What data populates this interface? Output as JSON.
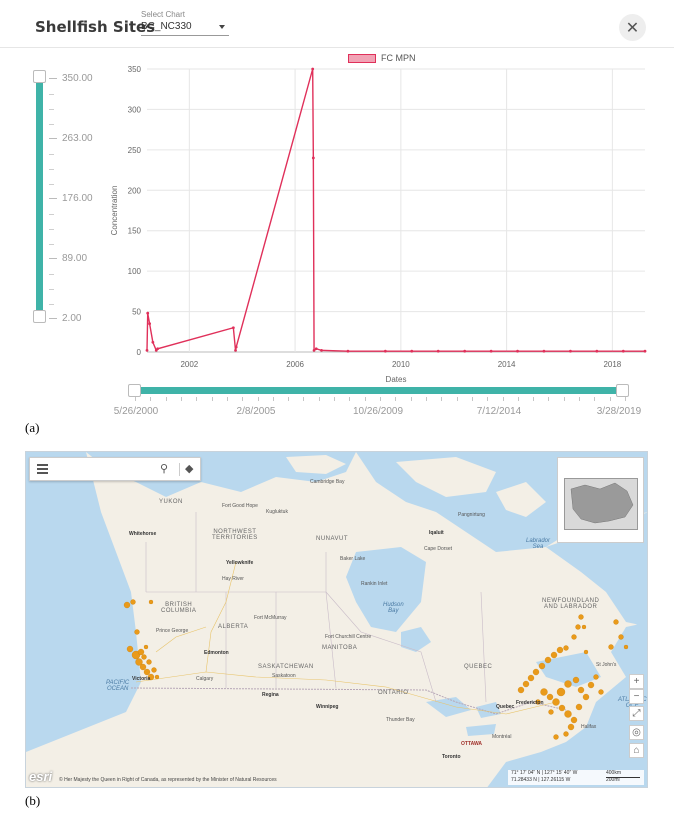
{
  "header": {
    "title": "Shellfish Sites",
    "select_label": "Select Chart",
    "select_value": "BC_NC330",
    "close_glyph": "✕"
  },
  "vslider": {
    "ticks": [
      "350.00",
      "263.00",
      "176.00",
      "89.00",
      "2.00"
    ],
    "range": [
      2.0,
      350.0
    ]
  },
  "hslider": {
    "labels": [
      "5/26/2000",
      "2/8/2005",
      "10/26/2009",
      "7/12/2014",
      "3/28/2019"
    ]
  },
  "chart_data": {
    "type": "line",
    "xlabel": "Dates",
    "ylabel": "Concentration",
    "xlim": [
      "2000-05-26",
      "2019-03-28"
    ],
    "ylim": [
      0,
      350
    ],
    "x_ticks": [
      "2002",
      "2006",
      "2010",
      "2014",
      "2018"
    ],
    "y_ticks": [
      "0",
      "50",
      "100",
      "150",
      "200",
      "250",
      "300",
      "350"
    ],
    "grid": true,
    "legend": "top-center",
    "color": "#e0305a",
    "series": [
      {
        "name": "FC MPN",
        "points": [
          [
            "2000-05-26",
            2
          ],
          [
            "2000-06-05",
            48
          ],
          [
            "2000-07-01",
            35
          ],
          [
            "2000-08-15",
            12
          ],
          [
            "2000-10-01",
            2
          ],
          [
            "2000-10-20",
            4
          ],
          [
            "2003-09-01",
            30
          ],
          [
            "2003-10-01",
            2
          ],
          [
            "2003-10-10",
            6
          ],
          [
            "2006-09-01",
            350
          ],
          [
            "2006-09-10",
            240
          ],
          [
            "2006-09-20",
            2
          ],
          [
            "2006-10-20",
            4
          ],
          [
            "2007-01-01",
            2
          ],
          [
            "2008-01-01",
            1
          ],
          [
            "2009-06-01",
            1
          ],
          [
            "2010-06-01",
            1
          ],
          [
            "2011-06-01",
            1
          ],
          [
            "2012-06-01",
            1
          ],
          [
            "2013-06-01",
            1
          ],
          [
            "2014-06-01",
            1
          ],
          [
            "2015-06-01",
            1
          ],
          [
            "2016-06-01",
            1
          ],
          [
            "2017-06-01",
            1
          ],
          [
            "2018-06-01",
            1
          ],
          [
            "2019-03-28",
            1
          ]
        ]
      }
    ]
  },
  "captions": {
    "a": "(a)",
    "b": "(b)"
  },
  "map": {
    "labels": {
      "yukon": "YUKON",
      "nwt": "NORTHWEST\nTERRITORIES",
      "nunavut": "NUNAVUT",
      "bc": "BRITISH\nCOLUMBIA",
      "alberta": "ALBERTA",
      "sask": "SASKATCHEWAN",
      "manitoba": "MANITOBA",
      "ontario": "ONTARIO",
      "quebec": "QUEBEC",
      "nfl": "NEWFOUNDLAND\nAND LABRADOR",
      "hudson": "Hudson\nBay",
      "labrador_sea": "Labrador\nSea",
      "pacific": "PACIFIC\nOCEAN",
      "atlantic": "ATLANTIC\nOCE",
      "whitehorse": "Whitehorse",
      "yellowknife": "Yellowknife",
      "iqaluit": "Iqaluit",
      "edmonton": "Edmonton",
      "calgary": "Calgary",
      "regina": "Regina",
      "winnipeg": "Winnipeg",
      "ottawa": "OTTAWA",
      "quebec_city": "Quebec",
      "fredericton": "Fredericton",
      "victoria": "Victoria",
      "toronto": "Toronto",
      "cambridge_bay": "Cambridge Bay",
      "rankin": "Rankin Inlet",
      "churchill": "Fort Churchill Centre",
      "fort_mcmurray": "Fort McMurray",
      "thunder_bay": "Thunder Bay",
      "st_johns": "St John's",
      "cape_dorset": "Cape Dorset",
      "baker_lake": "Baker Lake",
      "kugluktuk": "Kugluktuk",
      "pangnirtung": "Pangnirtung",
      "fort_good_hope": "Fort Good Hope",
      "hay_river": "Hay River",
      "prince_george": "Prince George",
      "saskatoon": "Saskatoon",
      "montreal": "Montréal",
      "halifax": "Halifax"
    },
    "attribution": "© Her Majesty the Queen in Right of Canada, as represented by the Minister of Natural Resources",
    "coords_line1": "71° 17' 04\" N | 127° 15' 40\" W",
    "coords_line2": "71.28433 N | 127.26115 W",
    "scale_top": "400km",
    "scale_bottom": "200mi",
    "esri": "esri",
    "icons": [
      "menu-icon",
      "search-icon",
      "layers-icon",
      "zoom-in-icon",
      "zoom-out-icon",
      "expand-icon",
      "locate-icon",
      "home-icon"
    ]
  }
}
